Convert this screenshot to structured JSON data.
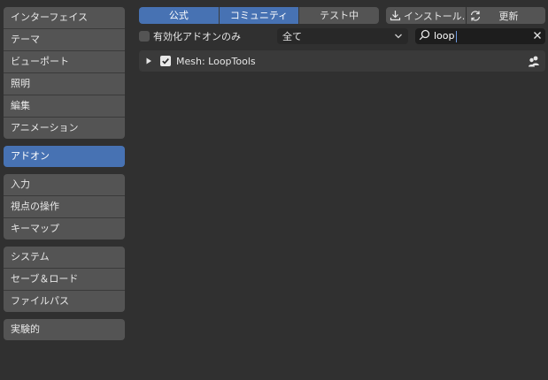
{
  "sidebar": {
    "groups": [
      {
        "items": [
          {
            "label": "インターフェイス"
          },
          {
            "label": "テーマ"
          },
          {
            "label": "ビューポート"
          },
          {
            "label": "照明"
          },
          {
            "label": "編集"
          },
          {
            "label": "アニメーション"
          }
        ]
      },
      {
        "items": [
          {
            "label": "アドオン",
            "active": true
          }
        ]
      },
      {
        "items": [
          {
            "label": "入力"
          },
          {
            "label": "視点の操作"
          },
          {
            "label": "キーマップ"
          }
        ]
      },
      {
        "items": [
          {
            "label": "システム"
          },
          {
            "label": "セーブ＆ロード"
          },
          {
            "label": "ファイルパス"
          }
        ]
      },
      {
        "items": [
          {
            "label": "実験的"
          }
        ]
      }
    ]
  },
  "support_tabs": [
    {
      "label": "公式",
      "selected": true
    },
    {
      "label": "コミュニティ",
      "selected": true
    },
    {
      "label": "テスト中",
      "selected": false
    }
  ],
  "toolbar": {
    "install_label": "インストール...",
    "refresh_label": "更新"
  },
  "filters": {
    "enabled_only_label": "有効化アドオンのみ",
    "category_value": "全て",
    "search_value": "loop"
  },
  "addons": [
    {
      "name": "Mesh: LoopTools",
      "enabled": true
    }
  ],
  "colors": {
    "accent": "#4772b3",
    "background": "#303030",
    "button": "#545454"
  }
}
